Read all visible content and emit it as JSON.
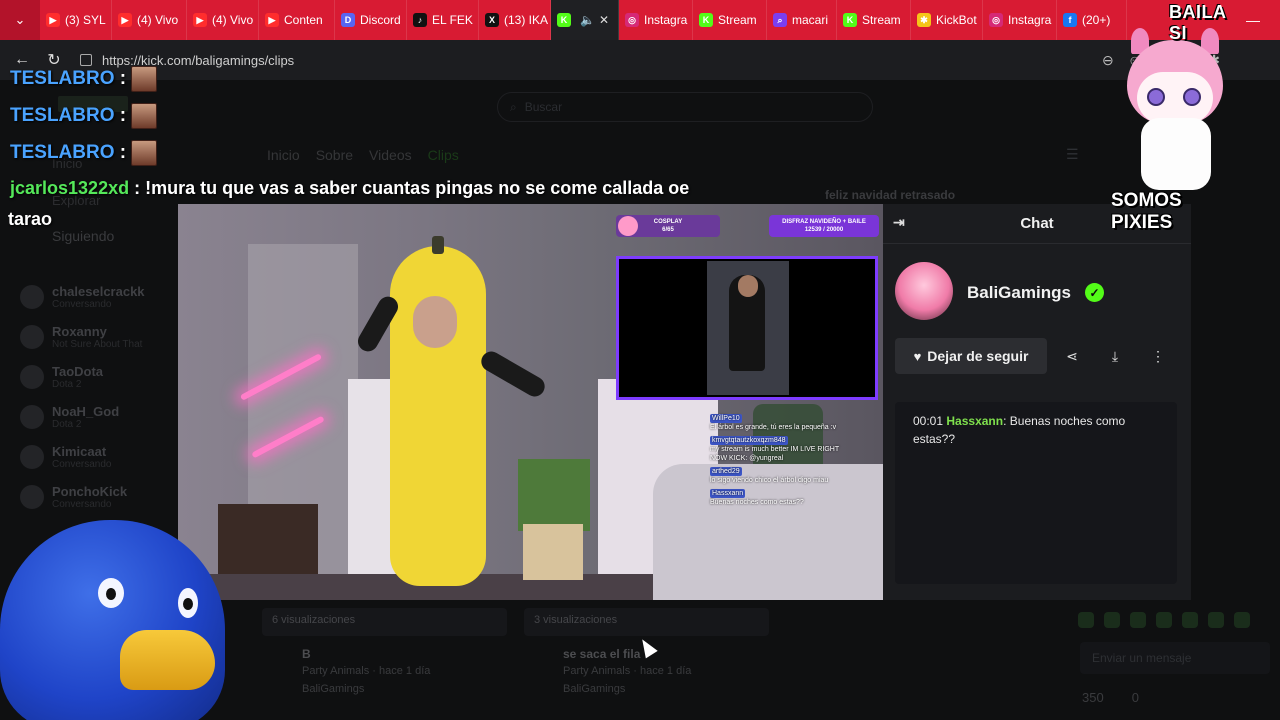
{
  "browser": {
    "tabs": [
      {
        "label": "(3) SYL",
        "color": "#ff2d2d",
        "glyph": "▶"
      },
      {
        "label": "(4) Vivo",
        "color": "#ff2d2d",
        "glyph": "▶"
      },
      {
        "label": "(4) Vivo",
        "color": "#ff2d2d",
        "glyph": "▶"
      },
      {
        "label": "Conten",
        "color": "#ff2d2d",
        "glyph": "▶"
      },
      {
        "label": "Discord",
        "color": "#5865f2",
        "glyph": "D"
      },
      {
        "label": "EL FEK",
        "color": "#111111",
        "glyph": "♪"
      },
      {
        "label": "(13) IKA",
        "color": "#111111",
        "glyph": "X"
      },
      {
        "label": "",
        "color": "#53fc18",
        "glyph": "K",
        "active": true
      },
      {
        "label": "Instagra",
        "color": "#d62976",
        "glyph": "◎"
      },
      {
        "label": "Stream",
        "color": "#53fc18",
        "glyph": "K"
      },
      {
        "label": "macari",
        "color": "#7b3ef0",
        "glyph": "⌕"
      },
      {
        "label": "Stream",
        "color": "#53fc18",
        "glyph": "K"
      },
      {
        "label": "KickBot",
        "color": "#f5c518",
        "glyph": "✱"
      },
      {
        "label": "Instagra",
        "color": "#d62976",
        "glyph": "◎"
      },
      {
        "label": "(20+)",
        "color": "#1877f2",
        "glyph": "f"
      }
    ],
    "url": "https://kick.com/baligamings/clips"
  },
  "page": {
    "search_placeholder": "Buscar",
    "profile_tabs": [
      "Inicio",
      "Sobre",
      "Videos",
      "Clips"
    ],
    "sidebar_links": [
      "Inicio",
      "Explorar",
      "Siguiendo"
    ],
    "sidebar_users": [
      {
        "name": "chaleselcrackk",
        "status": "Conversando"
      },
      {
        "name": "Roxanny",
        "status": "Not Sure About That"
      },
      {
        "name": "TaoDota",
        "status": "Dota 2"
      },
      {
        "name": "NoaH_God",
        "status": "Dota 2"
      },
      {
        "name": "Kimicaat",
        "status": "Conversando"
      },
      {
        "name": "PonchoKick",
        "status": "Conversando"
      }
    ],
    "clips": [
      {
        "views": "6 visualizaciones",
        "title": "B",
        "meta": "Party Animals · hace 1 día",
        "channel": "BaliGamings"
      },
      {
        "views": "3 visualizaciones",
        "title": "se saca el fila",
        "meta": "Party Animals · hace 1 día",
        "channel": "BaliGamings"
      }
    ],
    "ghost_feed": "feliz navidad retrasado",
    "send_placeholder": "Enviar un mensaje",
    "points": "350",
    "points2": "0"
  },
  "overlay_chat": {
    "lines": [
      {
        "user": "TESLABRO",
        "text": ""
      },
      {
        "user": "TESLABRO",
        "text": ""
      },
      {
        "user": "TESLABRO",
        "text": ""
      }
    ],
    "long_user": "jcarlos1322xd",
    "long_text_1": "!mura tu que vas a saber cuantas pingas no se come callada oe",
    "long_text_2": "tarao"
  },
  "video": {
    "label_cosplay": "COSPLAY",
    "label_cosplay_count": "6/65",
    "label_disfraz": "DISFRAZ NAVIDEÑO + BAILE",
    "label_disfraz_count": "12539 / 20000",
    "stream_chat": [
      {
        "user": "WillPe10",
        "text": "El árbol es grande, tú eres la pequeña :v"
      },
      {
        "user": "kmvgtqtautzkoxqzm848",
        "text": "my stream is much better IM LIVE RIGHT NOW KICK: @yungreal"
      },
      {
        "user": "arthed29",
        "text": "lo sigo viendo chico el árbol digo miau"
      },
      {
        "user": "Hassxann",
        "text": "Buenas noches como estas??"
      }
    ]
  },
  "chat_panel": {
    "title": "Chat",
    "channel_name": "BaliGamings",
    "unfollow_label": "Dejar de seguir",
    "message": {
      "time": "00:01",
      "user": "Hassxann",
      "text": "Buenas noches como estas??"
    }
  },
  "sticker": {
    "top_text": "BAILA SI",
    "bottom_text": "SOMOS PIXIES"
  }
}
